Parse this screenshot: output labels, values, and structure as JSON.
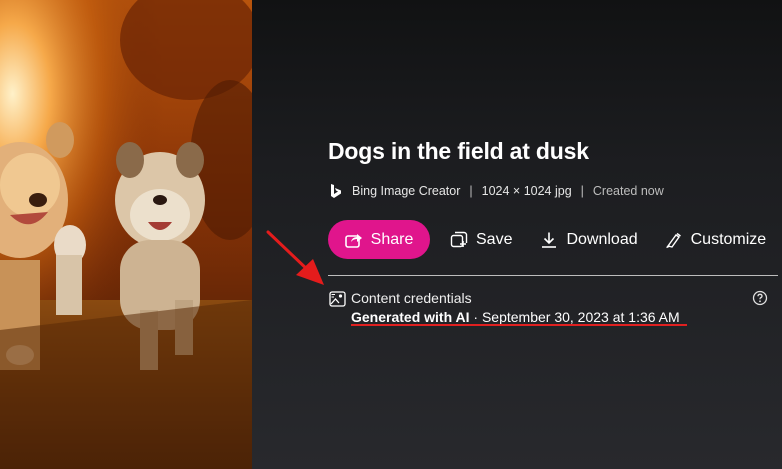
{
  "image": {
    "description_icon": "dogs-photo"
  },
  "detail": {
    "title": "Dogs in the field at dusk",
    "meta": {
      "source": "Bing Image Creator",
      "dimensions": "1024 × 1024 jpg",
      "created": "Created now",
      "separator": "|"
    },
    "actions": {
      "share": "Share",
      "save": "Save",
      "download": "Download",
      "customize": "Customize"
    },
    "credentials": {
      "label": "Content credentials",
      "generated": "Generated with AI",
      "date": " · September 30, 2023 at 1:36 AM"
    }
  },
  "colors": {
    "share_button": "#e0158c",
    "annotation_red": "#e02020",
    "panel_bg": "#202124"
  }
}
